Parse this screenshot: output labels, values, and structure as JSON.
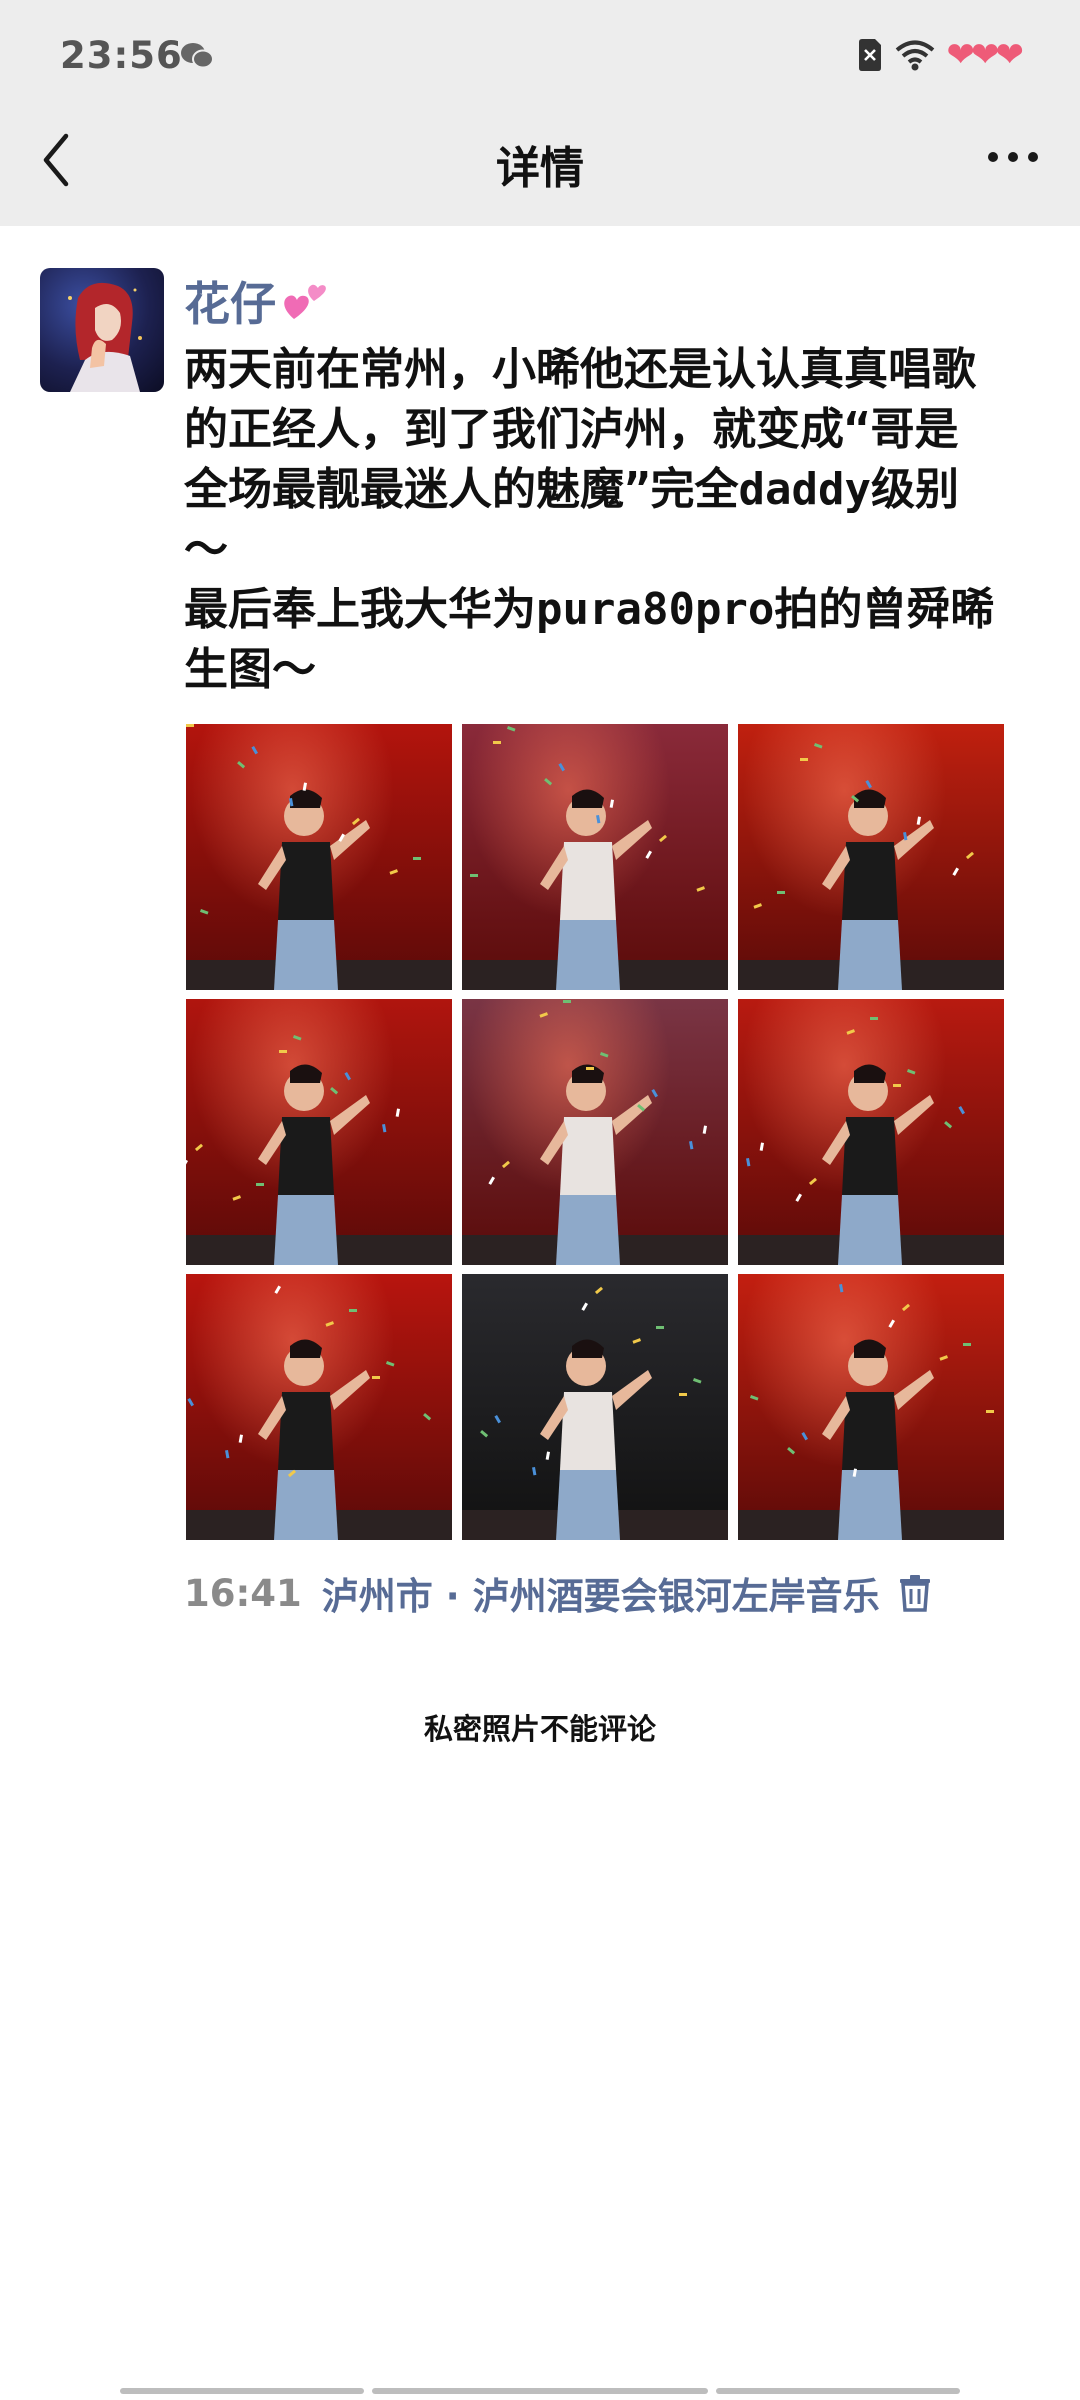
{
  "status_bar": {
    "time": "23:56",
    "icons": [
      "wechat-icon",
      "sim-card-icon",
      "wifi-icon",
      "hearts-icon"
    ],
    "hearts": "❤❤❤"
  },
  "nav": {
    "title": "详情",
    "back_icon": "chevron-left-icon",
    "more_icon": "more-dots-icon"
  },
  "post": {
    "username": "花仔",
    "username_emoji": "💕",
    "text": "两天前在常州，小晞他还是认认真真唱歌\n的正经人，到了我们泸州，就变成“哥是\n全场最靓最迷人的魅魔”完全daddy级别\n～\n最后奉上我大华为pura80pro拍的曾舜晞\n生图～",
    "photo_count": 9,
    "photos": [
      {
        "bg": "#b3140d"
      },
      {
        "bg": "#8a2a3a"
      },
      {
        "bg": "#c0200f"
      },
      {
        "bg": "#b0150e"
      },
      {
        "bg": "#7a3545"
      },
      {
        "bg": "#b81a10"
      },
      {
        "bg": "#b8150e"
      },
      {
        "bg": "#1b1b1f"
      },
      {
        "bg": "#c31f10"
      }
    ],
    "time": "16:41",
    "location": "泸州市 · 泸州酒要会银河左岸音乐",
    "delete_icon": "trash-icon"
  },
  "footer": {
    "private_note": "私密照片不能评论"
  },
  "colors": {
    "link": "#576b95",
    "header_bg": "#ededed"
  }
}
